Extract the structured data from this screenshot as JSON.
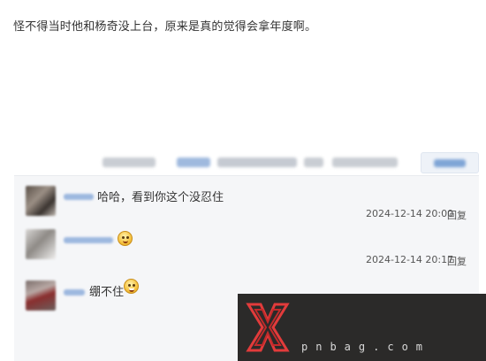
{
  "post": {
    "text": "怪不得当时他和杨奇没上台，原来是真的觉得会拿年度啊。"
  },
  "comments": [
    {
      "text": "哈哈，看到你这个没忍住",
      "time": "2024-12-14 20:00",
      "reply_label": "回复"
    },
    {
      "emoji": "smile-emoji",
      "time": "2024-12-14 20:17",
      "reply_label": "回复"
    },
    {
      "text": "绷不住",
      "emoji": "grin-emoji"
    }
  ],
  "watermark": {
    "text": "pnbag.com"
  },
  "colors": {
    "panel_bg": "#f5f6f8",
    "link_blue": "#9db8df",
    "watermark_bg": "#2b2a29",
    "logo_red": "#e23b3b"
  }
}
